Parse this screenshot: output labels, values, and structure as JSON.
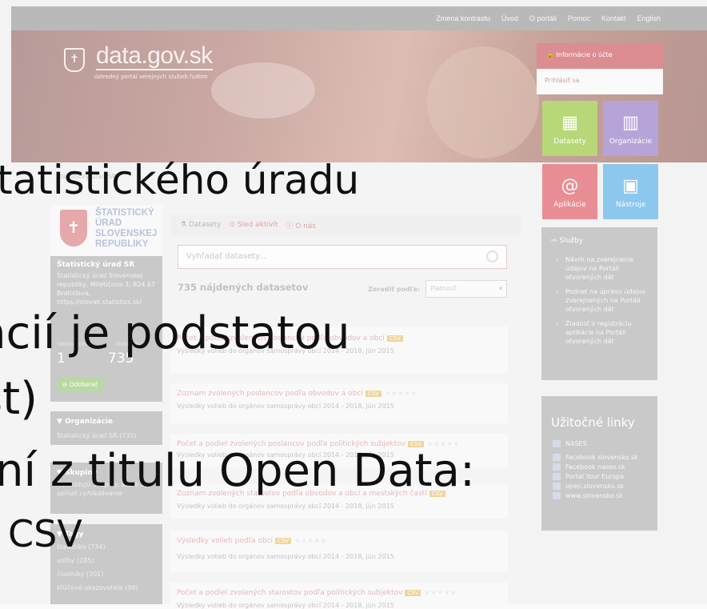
{
  "topbar": {
    "items": [
      "Zmena kontrastu",
      "Úvod",
      "O portáli",
      "Pomoc",
      "Kontakt",
      "English"
    ]
  },
  "logo": {
    "title": "data.gov.sk",
    "subtitle": "ústredný portál verejných služieb ľuďom"
  },
  "account": {
    "header": "Informácie o účte",
    "login": "Prihlásiť sa"
  },
  "tiles": [
    {
      "label": "Datasety",
      "icon": "film-icon",
      "color": "#b7d779"
    },
    {
      "label": "Organizácie",
      "icon": "building-icon",
      "color": "#b6a4d8"
    },
    {
      "label": "Aplikácie",
      "icon": "at-icon",
      "color": "#e98d94"
    },
    {
      "label": "Nástroje",
      "icon": "monitor-icon",
      "color": "#8cc7ee"
    }
  ],
  "org": {
    "logo_text": [
      "ŠTATISTICKÝ",
      "ÚRAD",
      "SLOVENSKEJ",
      "REPUBLIKY"
    ],
    "breadcrumb": "Štatistický úrad SR",
    "name": "Štatistický úrad SR",
    "address": [
      "Štatistický úrad Slovenskej",
      "republiky, Miletičova 3, 824 67",
      "Bratislava,",
      "https://slovak.statistics.sk/"
    ],
    "stat_labels": [
      "Sledovatelia",
      "Datasety"
    ],
    "stat_values": [
      "1",
      "735"
    ],
    "follow_button": "Odoberať"
  },
  "facets": {
    "organizations_header": "Organizácie",
    "organizations_item": "Štatistický úrad SR (735)",
    "groups_header": "Skupiny",
    "groups_text": [
      "Neexistujú Skupiny, ktoré by",
      "spĺňali vyhľadávanie"
    ],
    "tags_header": "Tagy",
    "tags": [
      "štatistika (734)",
      "voľby (285)",
      "číselníky (201)",
      "kľúčové ukazovatele (98)"
    ]
  },
  "tabs": [
    "Datasety",
    "Sled aktivít",
    "O nás"
  ],
  "search": {
    "placeholder": "Vyhľadať datasety..."
  },
  "results": {
    "count": "735 nájdených datasetov",
    "sort_label": "Zoradiť podľa:",
    "sort_value": "Platnosť"
  },
  "datasets": [
    {
      "title": "Počet a podiel zvolených poslancov podľa obvodov a obcí",
      "format": "CSV",
      "subtitle": "Výsledky volieb do orgánov samosprávy obcí 2014 - 2018, jún 2015"
    },
    {
      "title": "Zoznam zvolených poslancov podľa obvodov a obcí",
      "format": "CSV",
      "subtitle": "Výsledky volieb do orgánov samosprávy obcí 2014 - 2018, jún 2015"
    },
    {
      "title": "Počet a podiel zvolených poslancov podľa politických subjektov",
      "format": "CSV",
      "subtitle": "Výsledky volieb do orgánov samosprávy obcí 2014 - 2018, jún 2015"
    },
    {
      "title": "Zoznam zvolených starostov podľa obvodov a obcí a mestských častí",
      "format": "CSV",
      "subtitle": "Výsledky volieb do orgánov samosprávy obcí 2014 - 2018, jún 2015"
    },
    {
      "title": "Výsledky volieb podľa obcí",
      "format": "CSV",
      "subtitle": "Výsledky volieb do orgánov samosprávy obcí 2014 - 2018, jún 2015"
    },
    {
      "title": "Počet a podiel zvolených starostov podľa politických subjektov",
      "format": "CSV",
      "subtitle": "Výsledky volieb do orgánov samosprávy obcí 2014 - 2018, jún 2015"
    }
  ],
  "services": {
    "header": "Služby",
    "items": [
      "Návrh na zverejnenie údajov na Portáli otvorených dát",
      "Podnet na úpravu údajov zverejnených na Portáli otvorených dát",
      "Žiadosť o registráciu aplikácie na Portáli otvorených dát"
    ]
  },
  "useful_links": {
    "header": "Užitočné linky",
    "items": [
      "NASES",
      "Facebook slovensko.sk",
      "Facebook nases.sk",
      "Portal Your Europe",
      "open.slovensko.sk",
      "www.slovensko.sk"
    ]
  },
  "overlay": {
    "line1": "tatistického úradu",
    "line2": "ncií je podstatou",
    "line3": "st)",
    "line4": "ní z titulu Open Data:",
    "line5": "CSV"
  }
}
